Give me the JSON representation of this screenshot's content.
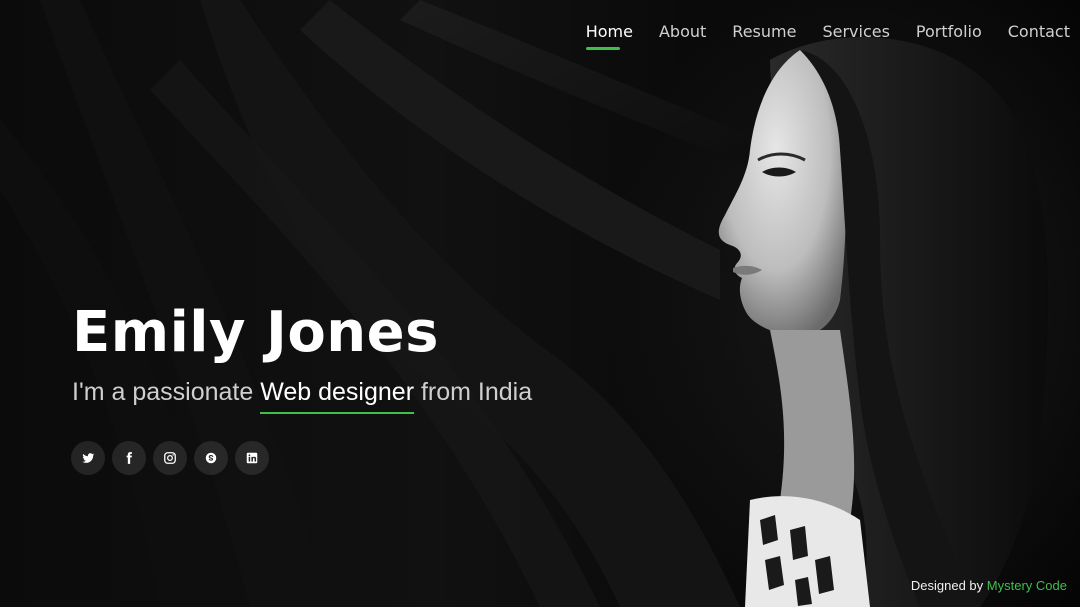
{
  "nav": {
    "items": [
      {
        "label": "Home",
        "active": true
      },
      {
        "label": "About"
      },
      {
        "label": "Resume"
      },
      {
        "label": "Services"
      },
      {
        "label": "Portfolio"
      },
      {
        "label": "Contact"
      }
    ]
  },
  "hero": {
    "name": "Emily Jones",
    "tagline_prefix": "I'm a passionate",
    "tagline_typed": "Web designer",
    "tagline_suffix": "from India"
  },
  "social": [
    {
      "icon": "twitter-icon"
    },
    {
      "icon": "facebook-icon"
    },
    {
      "icon": "instagram-icon"
    },
    {
      "icon": "skype-icon"
    },
    {
      "icon": "linkedin-icon"
    }
  ],
  "footer": {
    "credit_prefix": "Designed by",
    "credit_link": "Mystery Code"
  },
  "colors": {
    "accent": "#3fbf4b",
    "background": "#050505",
    "text": "#ffffff"
  }
}
